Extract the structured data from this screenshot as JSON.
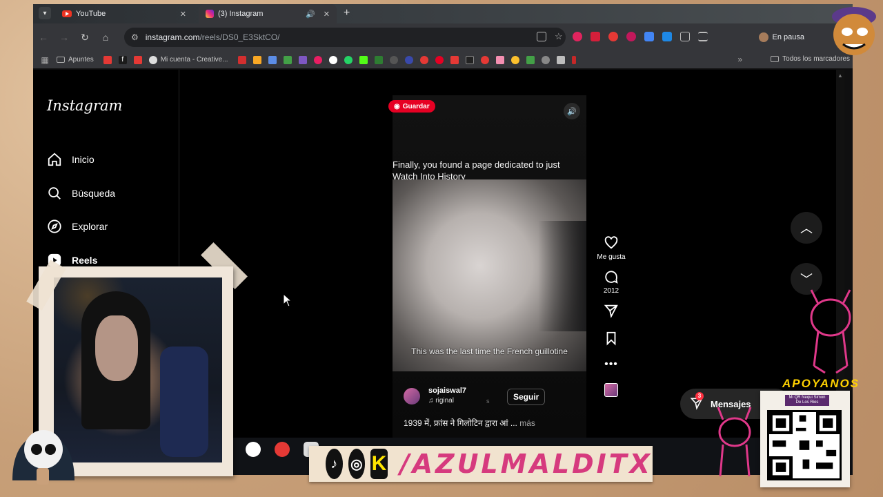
{
  "browser": {
    "tabs": [
      {
        "title": "YouTube",
        "icon": "youtube-icon"
      },
      {
        "title": "(3) Instagram",
        "icon": "instagram-icon",
        "active": true
      }
    ],
    "url_host": "instagram.com",
    "url_path": "/reels/DS0_E3SktCO/",
    "profile_status": "En pausa",
    "bookmarks": [
      "Apuntes",
      "Mi cuenta - Creative..."
    ],
    "bookmarks_all": "Todos los marcadores"
  },
  "instagram": {
    "logo": "Instagram",
    "nav": [
      {
        "label": "Inicio",
        "icon": "home-icon"
      },
      {
        "label": "Búsqueda",
        "icon": "search-icon"
      },
      {
        "label": "Explorar",
        "icon": "compass-icon"
      },
      {
        "label": "Reels",
        "icon": "reels-icon",
        "active": true
      }
    ],
    "reel": {
      "save_label": "Guardar",
      "caption_top": "Finally, you found a page dedicated to just Watch Into History",
      "subtitle": "This was the last time the French guillotine",
      "author": "sojaiswal7",
      "audio": "riginal",
      "follow_label": "Seguir",
      "description": "1939 में, फ्रांस ने गिलोटिन द्वारा आं ...",
      "more_label": "más"
    },
    "actions": {
      "like_label": "Me gusta",
      "comments_count": "2012"
    },
    "messages": {
      "label": "Mensajes",
      "badge": "3"
    }
  },
  "overlay": {
    "social_handle": "/AZULMALDITX",
    "support_label": "APOYANOS",
    "qr_caption": "Mi QR Nequi Simon De Los Rios"
  },
  "colors": {
    "instagram_bg": "#000000",
    "pinterest_red": "#e60023",
    "badge_red": "#ff3040",
    "handle_pink": "#d63a7e",
    "support_yellow": "#ffd200"
  }
}
